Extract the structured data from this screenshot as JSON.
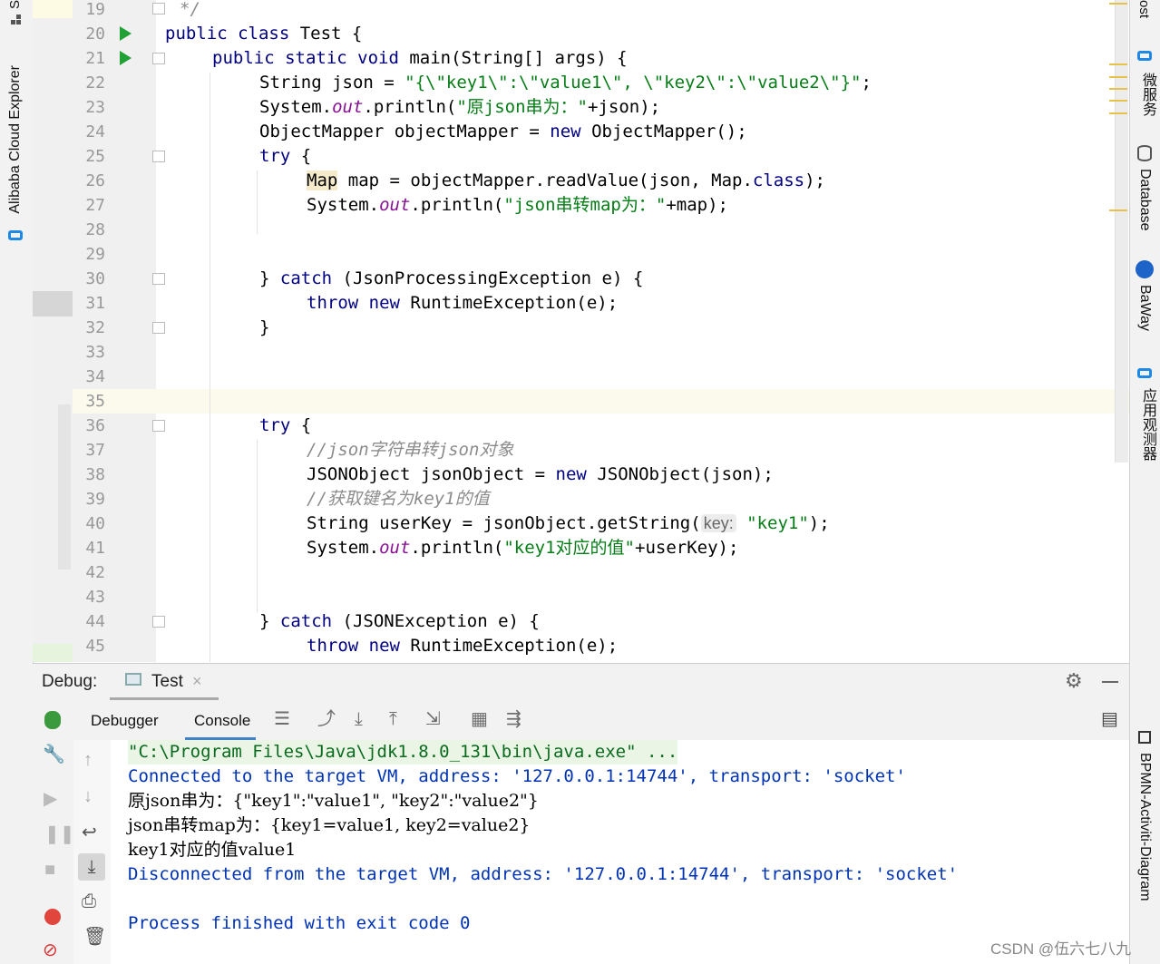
{
  "left_strip": {
    "label": "Alibaba Cloud Explorer",
    "top_cut": "S"
  },
  "right_strip": {
    "tools": [
      {
        "label": "ost"
      },
      {
        "label": "微服务"
      },
      {
        "label": "Database"
      },
      {
        "label": "BaWay"
      },
      {
        "label": "应用观测器"
      },
      {
        "label": "BPMN-Activiti-Diagram"
      }
    ]
  },
  "editor": {
    "lines": [
      {
        "num": "19"
      },
      {
        "num": "20"
      },
      {
        "num": "21"
      },
      {
        "num": "22"
      },
      {
        "num": "23"
      },
      {
        "num": "24"
      },
      {
        "num": "25"
      },
      {
        "num": "26"
      },
      {
        "num": "27"
      },
      {
        "num": "28"
      },
      {
        "num": "29"
      },
      {
        "num": "30"
      },
      {
        "num": "31"
      },
      {
        "num": "32"
      },
      {
        "num": "33"
      },
      {
        "num": "34"
      },
      {
        "num": "35"
      },
      {
        "num": "36"
      },
      {
        "num": "37"
      },
      {
        "num": "38"
      },
      {
        "num": "39"
      },
      {
        "num": "40"
      },
      {
        "num": "41"
      },
      {
        "num": "42"
      },
      {
        "num": "43"
      },
      {
        "num": "44"
      },
      {
        "num": "45"
      }
    ],
    "code": {
      "l19": "*/",
      "l20a": "public class",
      "l20b": " Test {",
      "l21a": "public static void",
      "l21b": " main(String[] args) {",
      "l22a": "String json = ",
      "l22b": "\"{\\\"key1\\\":\\\"value1\\\", \\\"key2\\\":\\\"value2\\\"}\"",
      "l22c": ";",
      "l23a": "System.",
      "l23b": "out",
      "l23c": ".println(",
      "l23d": "\"原json串为：\"",
      "l23e": "+json);",
      "l24a": "ObjectMapper objectMapper = ",
      "l24b": "new",
      "l24c": " ObjectMapper();",
      "l25a": "try",
      "l25b": " {",
      "l26a": "Map",
      "l26b": " map = objectMapper.readValue(json, Map.",
      "l26c": "class",
      "l26d": ");",
      "l27a": "System.",
      "l27b": "out",
      "l27c": ".println(",
      "l27d": "\"json串转map为：\"",
      "l27e": "+map);",
      "l30a": "} ",
      "l30b": "catch",
      "l30c": " (JsonProcessingException e) {",
      "l31a": "throw new",
      "l31b": " RuntimeException(e);",
      "l32": "}",
      "l36a": "try",
      "l36b": " {",
      "l37": "//json字符串转json对象",
      "l38a": "JSONObject jsonObject = ",
      "l38b": "new",
      "l38c": " JSONObject(json);",
      "l39": "//获取键名为key1的值",
      "l40a": "String userKey = jsonObject.getString(",
      "l40hint": "key:",
      "l40b": "\"key1\"",
      "l40c": ");",
      "l41a": "System.",
      "l41b": "out",
      "l41c": ".println(",
      "l41d": "\"key1对应的值\"",
      "l41e": "+userKey);",
      "l44a": "} ",
      "l44b": "catch",
      "l44c": " (JSONException e) {",
      "l45a": "throw new",
      "l45b": " RuntimeException(e);"
    }
  },
  "debug": {
    "title": "Debug:",
    "tab": "Test",
    "tabs": {
      "debugger": "Debugger",
      "console": "Console"
    },
    "console_lines": [
      "\"C:\\Program Files\\Java\\jdk1.8.0_131\\bin\\java.exe\" ...",
      "Connected to the target VM, address: '127.0.0.1:14744', transport: 'socket'",
      "原json串为：{\"key1\":\"value1\", \"key2\":\"value2\"}",
      "json串转map为：{key1=value1, key2=value2}",
      "key1对应的值value1",
      "Disconnected from the target VM, address: '127.0.0.1:14744', transport: 'socket'",
      "",
      "Process finished with exit code 0"
    ]
  },
  "watermark": "CSDN @伍六七八九"
}
